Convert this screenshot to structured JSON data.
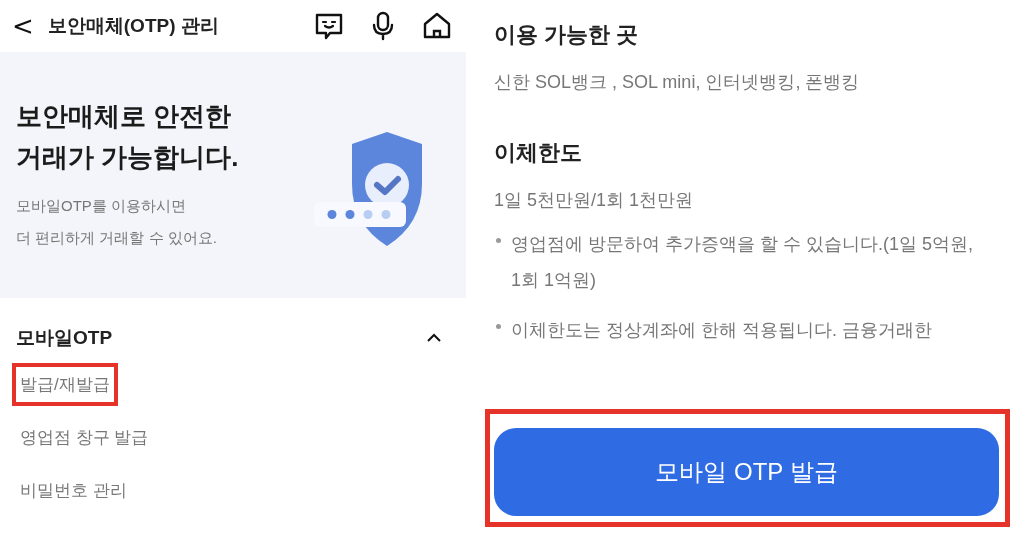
{
  "header": {
    "back": "<",
    "title": "보안매체(OTP) 관리"
  },
  "hero": {
    "title_lines": [
      "보안매체로 안전한",
      "거래가 가능합니다."
    ],
    "subtitle_lines": [
      "모바일OTP를 이용하시면",
      "더 편리하게 거래할 수 있어요."
    ]
  },
  "menu": {
    "title": "모바일OTP",
    "expanded": true,
    "items": [
      {
        "label": "발급/재발급",
        "highlighted": true
      },
      {
        "label": "영업점 창구 발급",
        "highlighted": false
      },
      {
        "label": "비밀번호 관리",
        "highlighted": false
      }
    ]
  },
  "details": [
    {
      "heading": "이용 가능한 곳",
      "lines": [
        "신한 SOL뱅크 , SOL mini, 인터넷뱅킹, 폰뱅킹"
      ]
    },
    {
      "heading": "이체한도",
      "lines": [
        "1일 5천만원/1회 1천만원"
      ],
      "bullets": [
        "영업점에 방문하여 추가증액을 할 수 있습니다.(1일 5억원, 1회 1억원)",
        "이체한도는 정상계좌에 한해 적용됩니다. 금융거래한"
      ]
    }
  ],
  "primary_button": {
    "label": "모바일 OTP 발급",
    "highlighted": true
  }
}
